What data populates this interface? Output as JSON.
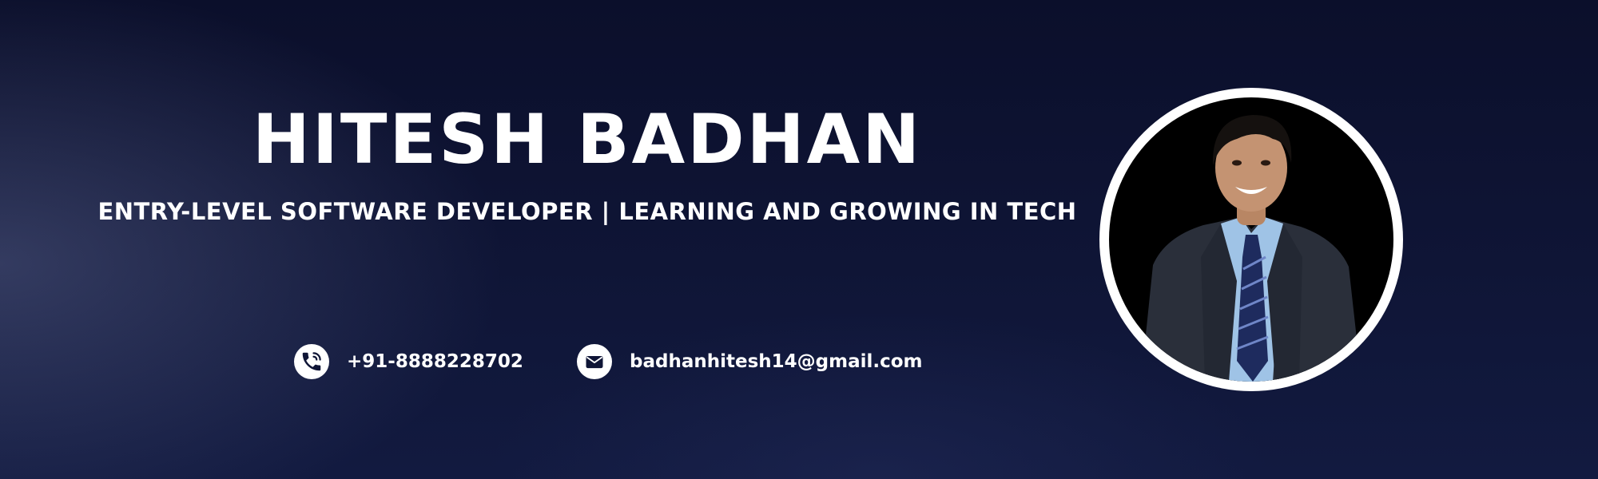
{
  "profile": {
    "name": "HITESH BADHAN",
    "tagline": "ENTRY-LEVEL SOFTWARE DEVELOPER | LEARNING AND GROWING IN TECH"
  },
  "contact": {
    "phone": {
      "icon": "phone-icon",
      "text": "+91-8888228702"
    },
    "email": {
      "icon": "mail-icon",
      "text": "badhanhitesh14@gmail.com"
    }
  },
  "colors": {
    "background": "#0f1536",
    "text": "#ffffff",
    "ring": "#ffffff"
  }
}
